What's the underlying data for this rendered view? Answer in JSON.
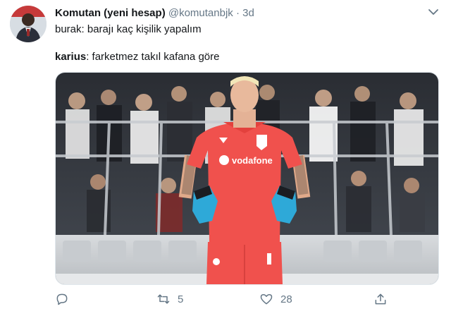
{
  "tweet": {
    "display_name": "Komutan (yeni hesap)",
    "handle": "@komutanbjk",
    "separator": "·",
    "time": "3d",
    "line1": "burak: barajı kaç kişilik yapalım",
    "line2_name": "karius",
    "line2_rest": ": farketmez takıl kafana göre",
    "avatar_icon": "profile-avatar",
    "photo_text": {
      "shirt_brand": "vodafone"
    }
  },
  "actions": {
    "retweet_count": "5",
    "like_count": "28",
    "icons": [
      "reply-icon",
      "retweet-icon",
      "like-icon",
      "share-icon"
    ]
  },
  "colors": {
    "text": "#14171a",
    "muted": "#657786",
    "kit_red": "#f0514d",
    "glove_blue": "#2ea9d8"
  }
}
